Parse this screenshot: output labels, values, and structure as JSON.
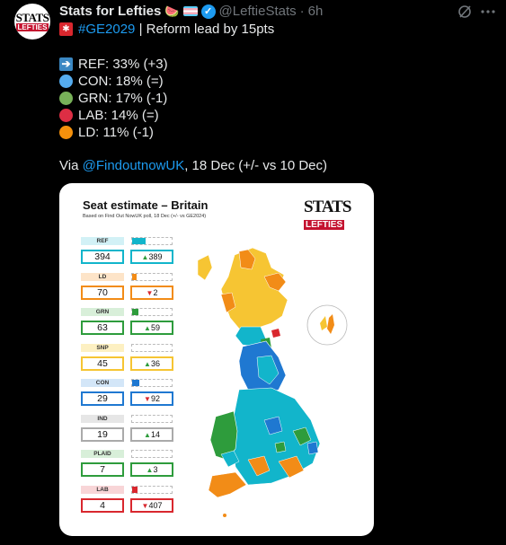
{
  "tweet": {
    "display_name": "Stats for Lefties",
    "handle": "@LeftieStats",
    "separator": "·",
    "time": "6h",
    "avatar_text": {
      "top": "STATS",
      "bottom": "LEFTIES"
    },
    "headline": {
      "hashtag": "#GE2029",
      "text": "| Reform lead by 15pts"
    },
    "polls": [
      {
        "icon": "right-arrow-icon",
        "text": "REF: 33% (+3)",
        "color": "#3b88c3"
      },
      {
        "icon": "blue-circle-icon",
        "text": "CON: 18% (=)",
        "color": "#55acee"
      },
      {
        "icon": "green-circle-icon",
        "text": "GRN: 17% (-1)",
        "color": "#78b159"
      },
      {
        "icon": "red-circle-icon",
        "text": "LAB: 14% (=)",
        "color": "#dd2e44"
      },
      {
        "icon": "orange-circle-icon",
        "text": "LD: 11% (-1)",
        "color": "#f4900c"
      }
    ],
    "via": {
      "prefix": "Via",
      "mention": "@FindoutnowUK",
      "suffix": ", 18 Dec (+/- vs 10 Dec)"
    }
  },
  "card": {
    "title": "Seat estimate – Britain",
    "subtitle": "Based on Find Out NowUK poll, 18 Dec (+/- vs GE2024)",
    "logo": {
      "top": "STATS",
      "bottom": "LEFTIES"
    },
    "parties": [
      {
        "label": "REF",
        "seats": "394",
        "change": "▲389",
        "dir": "up",
        "color": "#12b5cb",
        "label_bg": "#d2f1f6",
        "share": 0.33
      },
      {
        "label": "LD",
        "seats": "70",
        "change": "▼2",
        "dir": "down",
        "color": "#f28c17",
        "label_bg": "#fde4c8",
        "share": 0.11
      },
      {
        "label": "GRN",
        "seats": "63",
        "change": "▲59",
        "dir": "up",
        "color": "#2e9c3c",
        "label_bg": "#d8efd9",
        "share": 0.17
      },
      {
        "label": "SNP",
        "seats": "45",
        "change": "▲36",
        "dir": "up",
        "color": "#f6c533",
        "label_bg": "#fdf0c2",
        "share": 0
      },
      {
        "label": "CON",
        "seats": "29",
        "change": "▼92",
        "dir": "down",
        "color": "#1f78d1",
        "label_bg": "#d3e6f8",
        "share": 0.18
      },
      {
        "label": "IND",
        "seats": "19",
        "change": "▲14",
        "dir": "up",
        "color": "#aaaaaa",
        "label_bg": "#e6e6e6",
        "share": 0
      },
      {
        "label": "PLAID",
        "seats": "7",
        "change": "▲3",
        "dir": "up",
        "color": "#2e9c3c",
        "label_bg": "#d8efd9",
        "share": 0
      },
      {
        "label": "LAB",
        "seats": "4",
        "change": "▼407",
        "dir": "down",
        "color": "#d9272e",
        "label_bg": "#f8d5d7",
        "share": 0.14
      }
    ]
  },
  "map_colors": {
    "ref": "#12b5cb",
    "ld": "#f28c17",
    "snp": "#f6c533",
    "con": "#1f78d1",
    "grn": "#2e9c3c",
    "lab": "#d9272e"
  }
}
